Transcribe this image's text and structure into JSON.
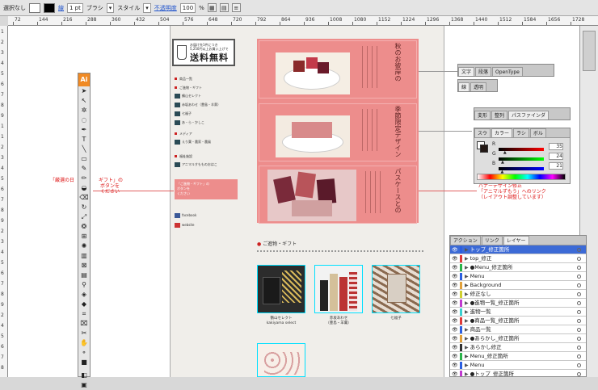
{
  "top_bar": {
    "selection_label": "選択なし",
    "stroke_label": "線",
    "stroke_weight": "1 pt",
    "brush_label": "ブラシ",
    "style_label": "スタイル",
    "opacity_label": "不透明度",
    "opacity_value": "100",
    "opacity_unit": "%"
  },
  "ruler": {
    "h_ticks": [
      "72",
      "144",
      "216",
      "288",
      "360",
      "432",
      "504",
      "576",
      "648",
      "720",
      "792",
      "864",
      "936",
      "1008",
      "1080",
      "1152",
      "1224",
      "1296",
      "1368",
      "1440",
      "1512",
      "1584",
      "1656",
      "1728"
    ],
    "v_ticks": [
      "1",
      "2",
      "3",
      "4",
      "5",
      "6",
      "7",
      "8",
      "9",
      "1",
      "1",
      "2",
      "3",
      "4",
      "5",
      "6",
      "7",
      "8",
      "9",
      "2",
      "3",
      "4",
      "5",
      "6",
      "7",
      "8",
      "9",
      "2",
      "4",
      "5",
      "6",
      "7",
      "8",
      "9"
    ]
  },
  "toolbox": {
    "header": "Ai"
  },
  "page": {
    "badge": {
      "line1": "お届け先1件につき",
      "line2": "5,250円以上お買い上げで",
      "title": "送料無料"
    },
    "nav": {
      "products": "商品一覧",
      "gift_header": "ご進物・ギフト",
      "gift_items": [
        "鶴山セレクト",
        "赤坂あわせ（豊島・羊羹）",
        "七福子"
      ],
      "gift_more": "あ・ら・かしこ",
      "media_header": "メディア",
      "media_items": [
        "えり葉・農家・農風"
      ],
      "shop_header": "福祉施設",
      "shop_items": [
        "アニマルすもものおはこ"
      ],
      "links": [
        "facebook",
        "website"
      ]
    },
    "pink_box_lines": [
      "「ご進物・ギフト」の",
      "ボタンを",
      "ください"
    ],
    "hero_titles": [
      "秋のお彼岸の",
      "季節限定デザイン",
      "パスケースとの"
    ],
    "section_title": "ご進物・ギフト",
    "products": [
      {
        "name": "鶴山セレクト",
        "sub": "kakiyama select"
      },
      {
        "name": "赤坂あわせ",
        "sub": "（豊島・羊羹）"
      },
      {
        "name": "七福子",
        "sub": ""
      }
    ],
    "annotations": {
      "left_1": "「厳選の日",
      "left_2": "ボタンを",
      "left_3": "ください",
      "left_4": "ギフト」の",
      "right_1": "バナーデザイン修正",
      "right_2": "「アニマルずもう」へのリンク",
      "right_3": "（レイアウト調整しています）"
    }
  },
  "panels": {
    "char": {
      "tabs": [
        "文字",
        "段落",
        "OpenType"
      ]
    },
    "stroke": {
      "tabs": [
        "線",
        "透明"
      ]
    },
    "pathfinder": {
      "tabs": [
        "変形",
        "整列",
        "パスファインダ"
      ]
    },
    "color": {
      "tabs": [
        "スウ",
        "カラー",
        "ラシ",
        "ボル"
      ],
      "r_label": "R",
      "g_label": "G",
      "b_label": "B",
      "r": "35",
      "g": "24",
      "b": "21",
      "r_pct": 0.14,
      "g_pct": 0.09,
      "b_pct": 0.08
    },
    "layers": {
      "tabs": [
        "アクション",
        "リンク",
        "レイヤー"
      ],
      "rows": [
        {
          "label": "トップ_修正箇所",
          "color": "#2b5ee0"
        },
        {
          "label": "top_修正",
          "color": "#e03a3a"
        },
        {
          "label": "●Menu_修正箇所",
          "color": "#2ab44a"
        },
        {
          "label": "Menu",
          "color": "#2b5ee0"
        },
        {
          "label": "Background",
          "color": "#e0a03a"
        },
        {
          "label": "修正なし",
          "color": "#cfcf30"
        },
        {
          "label": "●進物一覧_修正箇所",
          "color": "#c03ad0"
        },
        {
          "label": "進物一覧",
          "color": "#3ad0d0"
        },
        {
          "label": "●商品一覧_修正箇所",
          "color": "#e03a3a"
        },
        {
          "label": "商品一覧",
          "color": "#2b5ee0"
        },
        {
          "label": "●あらかし_修正箇所",
          "color": "#e0a03a"
        },
        {
          "label": "あらかし修正",
          "color": "#333333"
        },
        {
          "label": "Menu_修正箇所",
          "color": "#2ab44a"
        },
        {
          "label": "Menu",
          "color": "#2b5ee0"
        },
        {
          "label": "●トップ_修正箇所",
          "color": "#c03ad0"
        }
      ]
    }
  }
}
